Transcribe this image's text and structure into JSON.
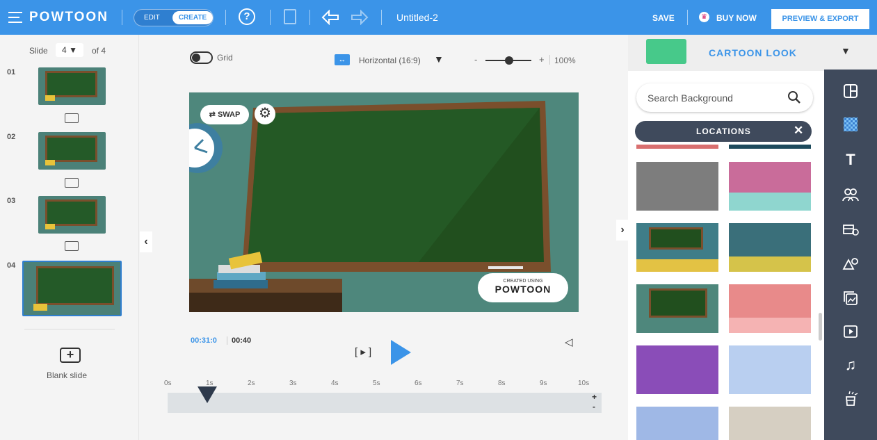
{
  "header": {
    "logo": "POWTOON",
    "mode_edit": "EDIT",
    "mode_create": "CREATE",
    "title": "Untitled-2",
    "save": "SAVE",
    "buy_now": "BUY NOW",
    "preview_export": "PREVIEW & EXPORT",
    "brand_color": "#3b94e8"
  },
  "slides": {
    "label": "Slide",
    "current": "4",
    "of_label": "of 4",
    "items": [
      {
        "num": "01"
      },
      {
        "num": "02"
      },
      {
        "num": "03"
      },
      {
        "num": "04"
      }
    ],
    "blank_label": "Blank slide"
  },
  "canvas": {
    "grid_label": "Grid",
    "orientation": "Horizontal (16:9)",
    "zoom_minus": "-",
    "zoom_plus": "+",
    "zoom": "100%",
    "swap": "SWAP",
    "watermark_small": "CREATED USING",
    "watermark_brand": "POWTOON"
  },
  "timeline": {
    "current": "00:31:0",
    "total": "00:40",
    "play_scene": "[ ▸ ]",
    "ticks": [
      "0s",
      "1s",
      "2s",
      "3s",
      "4s",
      "5s",
      "6s",
      "7s",
      "8s",
      "9s",
      "10s"
    ],
    "plus": "+",
    "minus": "-"
  },
  "rightpanel": {
    "style": "CARTOON LOOK",
    "search_placeholder": "Search Background",
    "category": "LOCATIONS"
  },
  "toolbar": {
    "items": [
      "layout-icon",
      "background-icon",
      "text-icon",
      "characters-icon",
      "props-icon",
      "shapes-icon",
      "media-icon",
      "video-icon",
      "music-icon",
      "special-icon"
    ]
  }
}
